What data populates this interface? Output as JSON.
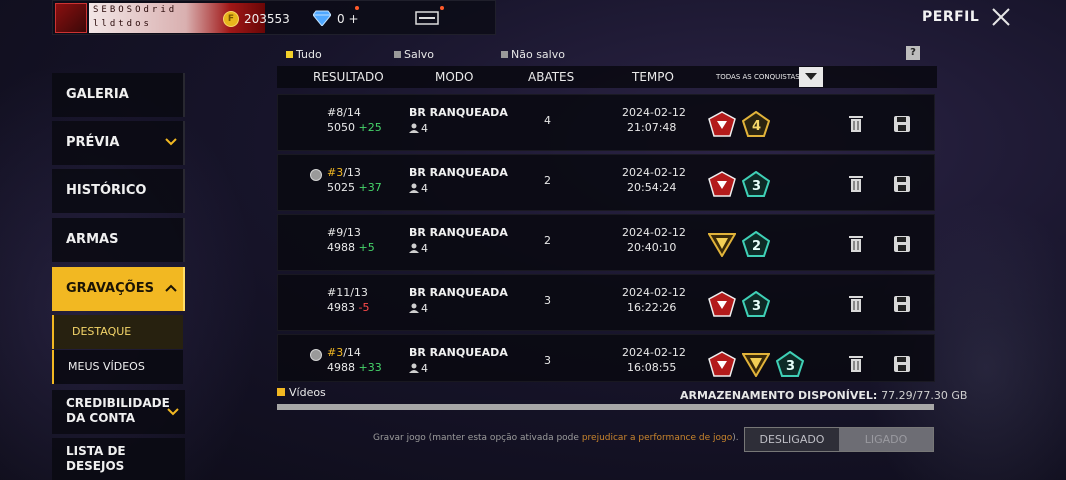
{
  "topbar": {
    "nick_line1": "SEBOSOdrid",
    "nick_line2": "lldtdos",
    "gold_icon_letter": "F",
    "gold": "203553",
    "diamonds": "0 +",
    "profile_label": "PERFIL"
  },
  "sidebar": {
    "items": [
      {
        "label": "GALERIA"
      },
      {
        "label": "PRÉVIA"
      },
      {
        "label": "HISTÓRICO"
      },
      {
        "label": "ARMAS"
      },
      {
        "label": "GRAVAÇÕES"
      }
    ],
    "sub_items": [
      {
        "label": "DESTAQUE"
      },
      {
        "label": "MEUS VÍDEOS"
      }
    ],
    "credibility_line1": "CREDIBILIDADE",
    "credibility_line2": "DA CONTA",
    "wishlist_line1": "LISTA DE",
    "wishlist_line2": "DESEJOS"
  },
  "filters": {
    "all": "Tudo",
    "saved": "Salvo",
    "unsaved": "Não salvo",
    "help": "?"
  },
  "table": {
    "headers": {
      "result": "RESULTADO",
      "mode": "MODO",
      "kills": "ABATES",
      "time": "TEMPO",
      "achievements": "TODAS AS CONQUISTAS"
    },
    "rows": [
      {
        "rank": "#8",
        "total": "/14",
        "points": "5050",
        "delta": "+25",
        "mode": "BR RANQUEADA",
        "squad": "4",
        "kills": "4",
        "date": "2024-02-12",
        "time": "21:07:48"
      },
      {
        "rank": "#3",
        "total": "/13",
        "points": "5025",
        "delta": "+37",
        "mode": "BR RANQUEADA",
        "squad": "4",
        "kills": "2",
        "date": "2024-02-12",
        "time": "20:54:24"
      },
      {
        "rank": "#9",
        "total": "/13",
        "points": "4988",
        "delta": "+5",
        "mode": "BR RANQUEADA",
        "squad": "4",
        "kills": "2",
        "date": "2024-02-12",
        "time": "20:40:10"
      },
      {
        "rank": "#11",
        "total": "/13",
        "points": "4983",
        "delta": "-5",
        "mode": "BR RANQUEADA",
        "squad": "4",
        "kills": "3",
        "date": "2024-02-12",
        "time": "16:22:26"
      },
      {
        "rank": "#3",
        "total": "/14",
        "points": "4988",
        "delta": "+33",
        "mode": "BR RANQUEADA",
        "squad": "4",
        "kills": "3",
        "date": "2024-02-12",
        "time": "16:08:55"
      }
    ]
  },
  "footer": {
    "videos_label": "Vídeos",
    "storage_label": "ARMAZENAMENTO DISPONÍVEL:",
    "storage_value": "77.29/77.30 GB",
    "storage_fraction": 0.9999,
    "record_text_prefix": "Gravar jogo (manter esta opção ativada pode",
    "record_text_warn": "prejudicar a performance de jogo",
    "record_text_suffix": ").",
    "toggle_off": "DESLIGADO",
    "toggle_on": "LIGADO"
  },
  "colors": {
    "accent": "#f2b822",
    "positive": "#46d46a",
    "negative": "#ff4a4a"
  }
}
